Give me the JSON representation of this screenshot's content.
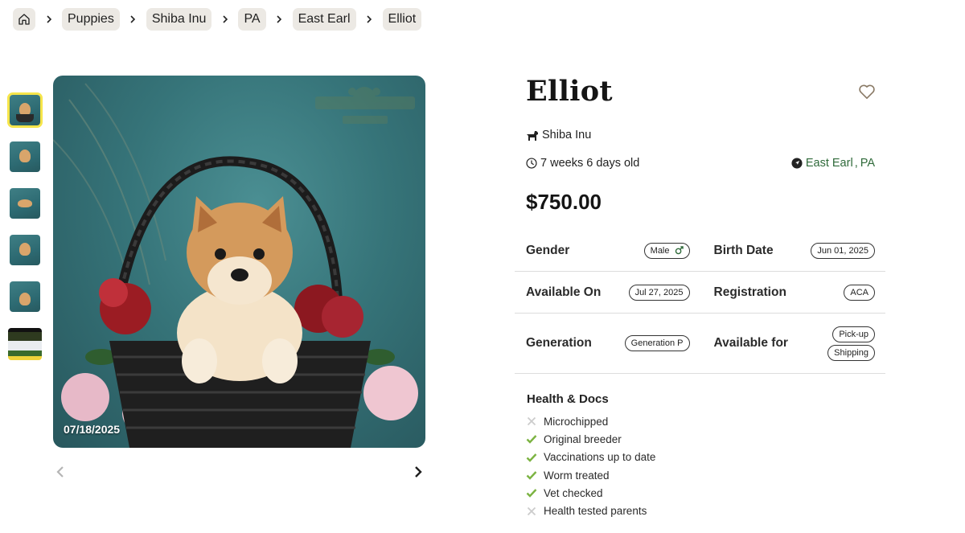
{
  "breadcrumb": {
    "home_icon": "home-icon",
    "items": [
      {
        "label": "Puppies"
      },
      {
        "label": "Shiba Inu"
      },
      {
        "label": "PA"
      },
      {
        "label": "East Earl"
      },
      {
        "label": "Elliot"
      }
    ]
  },
  "gallery": {
    "date_label": "07/18/2025",
    "thumbnail_count": 6,
    "active_thumbnail": 1,
    "accent_color": "#f6e54a"
  },
  "puppy": {
    "name": "Elliot",
    "breed": "Shiba Inu",
    "age": "7 weeks 6 days old",
    "location_city": "East Earl",
    "location_sep": ",",
    "location_state": "PA",
    "price": "$750.00"
  },
  "attributes": {
    "gender_label": "Gender",
    "gender_value": "Male",
    "birth_label": "Birth Date",
    "birth_value": "Jun 01, 2025",
    "available_on_label": "Available On",
    "available_on_value": "Jul 27, 2025",
    "registration_label": "Registration",
    "registration_value": "ACA",
    "generation_label": "Generation",
    "generation_value": "Generation P",
    "available_for_label": "Available for",
    "available_for_values": [
      "Pick-up",
      "Shipping"
    ]
  },
  "health": {
    "title": "Health & Docs",
    "items": [
      {
        "label": "Microchipped",
        "status": "no"
      },
      {
        "label": "Original breeder",
        "status": "yes"
      },
      {
        "label": "Vaccinations up to date",
        "status": "yes"
      },
      {
        "label": "Worm treated",
        "status": "yes"
      },
      {
        "label": "Vet checked",
        "status": "yes"
      },
      {
        "label": "Health tested parents",
        "status": "no"
      }
    ],
    "yes_color": "#7cb342",
    "no_color": "#cccccc"
  },
  "colors": {
    "location_green": "#2f6a3a",
    "crumb_bg": "#ece9e4",
    "heart": "#8a7a66"
  }
}
